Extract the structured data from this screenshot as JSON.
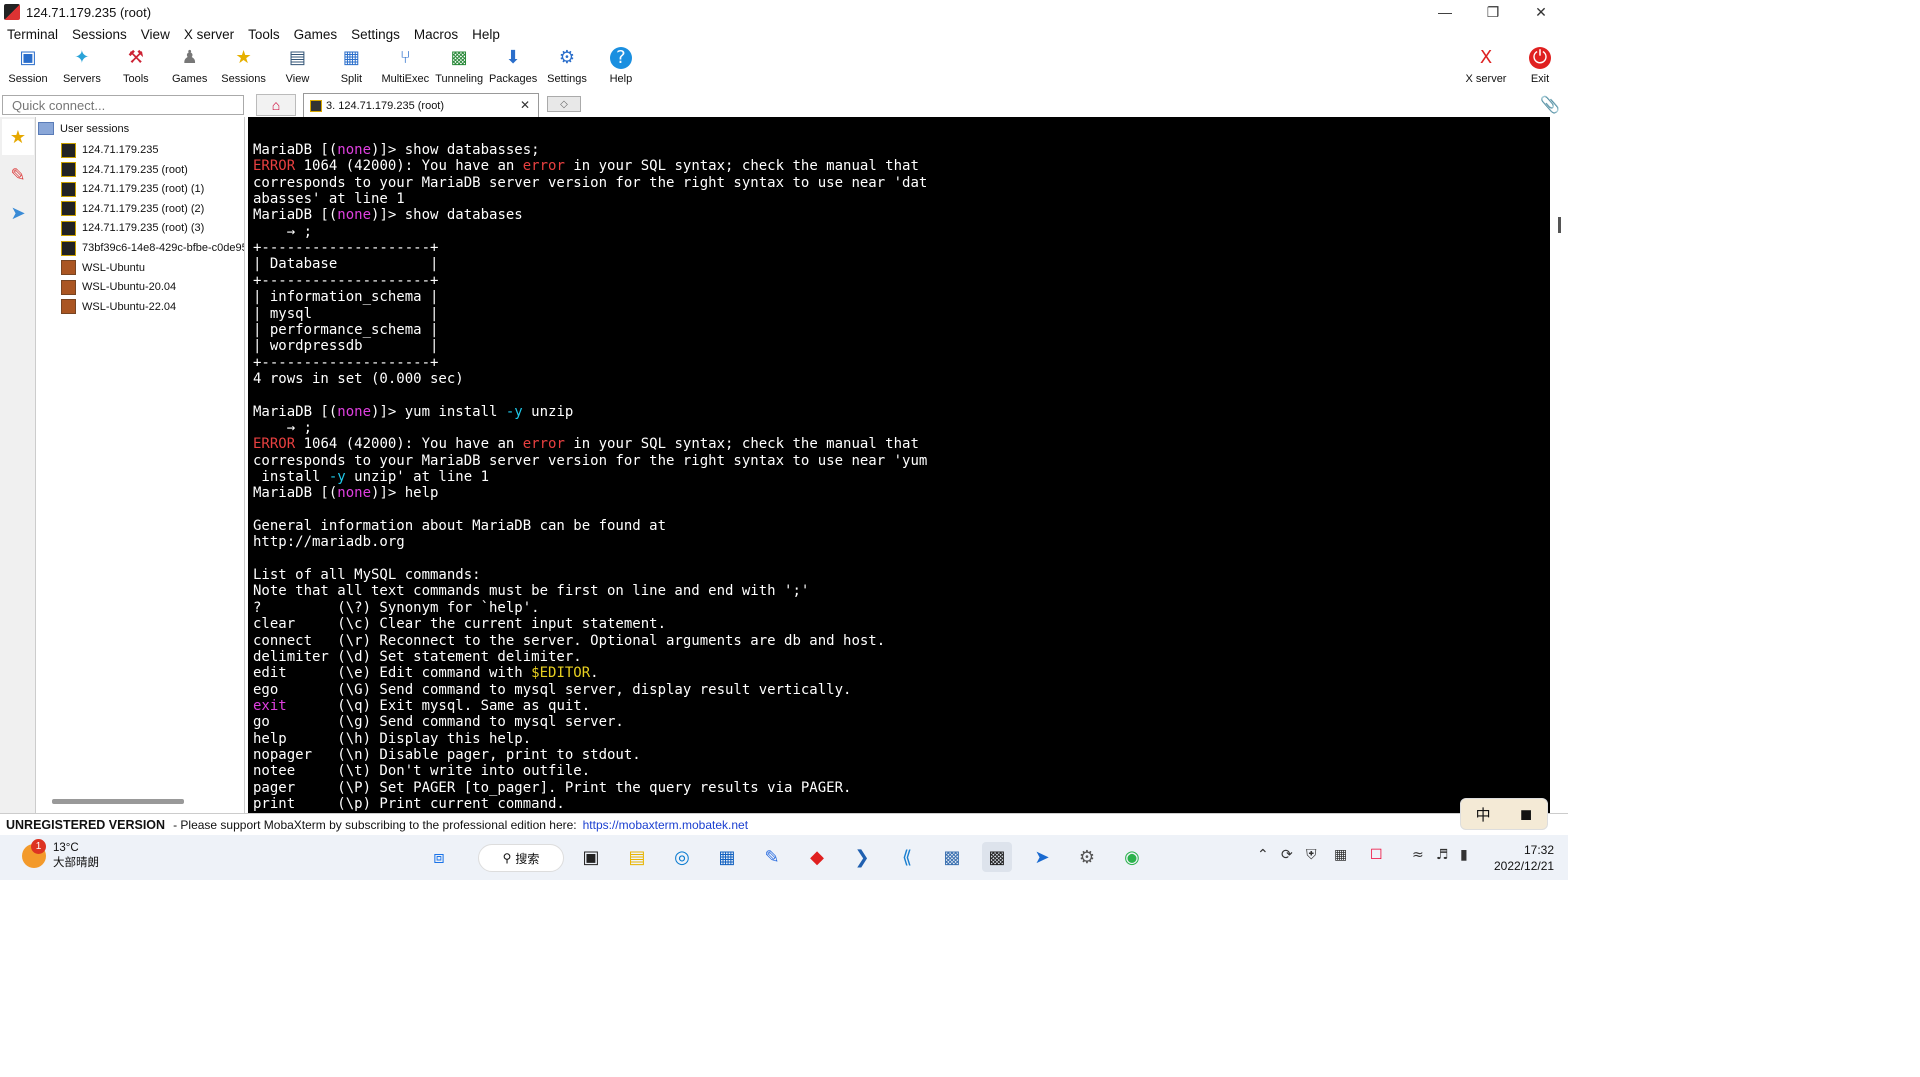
{
  "window": {
    "title": "124.71.179.235 (root)",
    "controls": [
      "minimize-icon",
      "restore-icon",
      "close-icon"
    ]
  },
  "menu": [
    "Terminal",
    "Sessions",
    "View",
    "X server",
    "Tools",
    "Games",
    "Settings",
    "Macros",
    "Help"
  ],
  "toolbar": [
    {
      "label": "Session",
      "icon": "session-icon"
    },
    {
      "label": "Servers",
      "icon": "servers-icon"
    },
    {
      "label": "Tools",
      "icon": "tools-icon"
    },
    {
      "label": "Games",
      "icon": "games-icon"
    },
    {
      "label": "Sessions",
      "icon": "sessions-star-icon"
    },
    {
      "label": "View",
      "icon": "view-icon"
    },
    {
      "label": "Split",
      "icon": "split-icon"
    },
    {
      "label": "MultiExec",
      "icon": "multiexec-icon"
    },
    {
      "label": "Tunneling",
      "icon": "tunneling-icon"
    },
    {
      "label": "Packages",
      "icon": "packages-icon"
    },
    {
      "label": "Settings",
      "icon": "settings-icon"
    },
    {
      "label": "Help",
      "icon": "help-icon"
    }
  ],
  "toolbar_right": [
    {
      "label": "X server",
      "icon": "xserver-icon"
    },
    {
      "label": "Exit",
      "icon": "power-icon"
    }
  ],
  "quick_connect": {
    "placeholder": "Quick connect..."
  },
  "tabs": {
    "active": "3. 124.71.179.235 (root)"
  },
  "sessions": {
    "root_label": "User sessions",
    "items": [
      {
        "label": "124.71.179.235",
        "type": "ssh"
      },
      {
        "label": "124.71.179.235 (root)",
        "type": "ssh"
      },
      {
        "label": "124.71.179.235 (root) (1)",
        "type": "ssh"
      },
      {
        "label": "124.71.179.235 (root) (2)",
        "type": "ssh"
      },
      {
        "label": "124.71.179.235 (root) (3)",
        "type": "ssh"
      },
      {
        "label": "73bf39c6-14e8-429c-bfbe-c0de95",
        "type": "ssh"
      },
      {
        "label": "WSL-Ubuntu",
        "type": "wsl"
      },
      {
        "label": "WSL-Ubuntu-20.04",
        "type": "wsl"
      },
      {
        "label": "WSL-Ubuntu-22.04",
        "type": "wsl"
      }
    ]
  },
  "terminal": {
    "lines": [
      [
        {
          "t": "MariaDB [("
        },
        {
          "t": "none",
          "c": "pink"
        },
        {
          "t": ")]> show databasses;"
        }
      ],
      [
        {
          "t": "ERROR",
          "c": "red"
        },
        {
          "t": " 1064 (42000): You have an "
        },
        {
          "t": "error",
          "c": "red"
        },
        {
          "t": " in your SQL syntax; check the manual that"
        }
      ],
      [
        {
          "t": "corresponds to your MariaDB server version for the right syntax to use near 'dat"
        }
      ],
      [
        {
          "t": "abasses' at line 1"
        }
      ],
      [
        {
          "t": "MariaDB [("
        },
        {
          "t": "none",
          "c": "pink"
        },
        {
          "t": ")]> show databases"
        }
      ],
      [
        {
          "t": "    → ;"
        }
      ],
      [
        {
          "t": "+--------------------+"
        }
      ],
      [
        {
          "t": "| Database           |"
        }
      ],
      [
        {
          "t": "+--------------------+"
        }
      ],
      [
        {
          "t": "| information_schema |"
        }
      ],
      [
        {
          "t": "| mysql              |"
        }
      ],
      [
        {
          "t": "| performance_schema |"
        }
      ],
      [
        {
          "t": "| wordpressdb        |"
        }
      ],
      [
        {
          "t": "+--------------------+"
        }
      ],
      [
        {
          "t": "4 rows in set (0.000 sec)"
        }
      ],
      [
        {
          "t": ""
        }
      ],
      [
        {
          "t": "MariaDB [("
        },
        {
          "t": "none",
          "c": "pink"
        },
        {
          "t": ")]> yum install "
        },
        {
          "t": "-y",
          "c": "cyan"
        },
        {
          "t": " unzip"
        }
      ],
      [
        {
          "t": "    → ;"
        }
      ],
      [
        {
          "t": "ERROR",
          "c": "red"
        },
        {
          "t": " 1064 (42000): You have an "
        },
        {
          "t": "error",
          "c": "red"
        },
        {
          "t": " in your SQL syntax; check the manual that"
        }
      ],
      [
        {
          "t": "corresponds to your MariaDB server version for the right syntax to use near 'yum"
        }
      ],
      [
        {
          "t": " install "
        },
        {
          "t": "-y",
          "c": "cyan"
        },
        {
          "t": " unzip' at line 1"
        }
      ],
      [
        {
          "t": "MariaDB [("
        },
        {
          "t": "none",
          "c": "pink"
        },
        {
          "t": ")]> help"
        }
      ],
      [
        {
          "t": ""
        }
      ],
      [
        {
          "t": "General information about MariaDB can be found at"
        }
      ],
      [
        {
          "t": "http://mariadb.org"
        }
      ],
      [
        {
          "t": ""
        }
      ],
      [
        {
          "t": "List of all MySQL commands:"
        }
      ],
      [
        {
          "t": "Note that all text commands must be first on line and end with ';'"
        }
      ],
      [
        {
          "t": "?         (\\?) Synonym for `help'."
        }
      ],
      [
        {
          "t": "clear     (\\c) Clear the current input statement."
        }
      ],
      [
        {
          "t": "connect   (\\r) Reconnect to the server. Optional arguments are db and host."
        }
      ],
      [
        {
          "t": "delimiter (\\d) Set statement delimiter."
        }
      ],
      [
        {
          "t": "edit      (\\e) Edit command with "
        },
        {
          "t": "$EDITOR",
          "c": "yel"
        },
        {
          "t": "."
        }
      ],
      [
        {
          "t": "ego       (\\G) Send command to mysql server, display result vertically."
        }
      ],
      [
        {
          "t": "exit",
          "c": "pink"
        },
        {
          "t": "      (\\q) Exit mysql. Same as quit."
        }
      ],
      [
        {
          "t": "go        (\\g) Send command to mysql server."
        }
      ],
      [
        {
          "t": "help      (\\h) Display this help."
        }
      ],
      [
        {
          "t": "nopager   (\\n) Disable pager, print to stdout."
        }
      ],
      [
        {
          "t": "notee     (\\t) Don't write into outfile."
        }
      ],
      [
        {
          "t": "pager     (\\P) Set PAGER [to_pager]. Print the query results via PAGER."
        }
      ],
      [
        {
          "t": "print     (\\p) Print current command."
        }
      ]
    ]
  },
  "status": {
    "unregistered": "UNREGISTERED VERSION",
    "message": "-  Please support MobaXterm by subscribing to the professional edition here:",
    "link": "https://mobaxterm.mobatek.net"
  },
  "ime": {
    "lang": "中"
  },
  "taskbar": {
    "weather": {
      "temp": "13°C",
      "desc": "大部晴朗",
      "badge": "1"
    },
    "search": "搜索",
    "clock": {
      "time": "17:32",
      "date": "2022/12/21"
    }
  },
  "colors": {
    "terminal_bg": "#000000",
    "pink": "#e040e0",
    "red": "#e84040",
    "cyan": "#20c8e8",
    "yellow": "#e8d020"
  }
}
